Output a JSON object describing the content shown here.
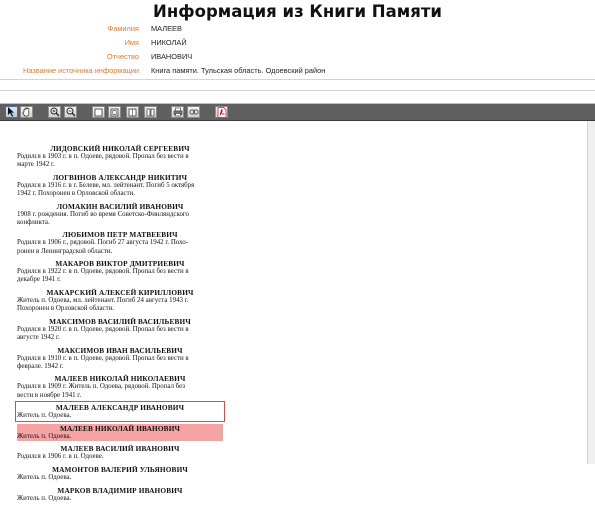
{
  "page": {
    "title": "Информация из Книги Памяти"
  },
  "meta": [
    {
      "label": "Фамилия",
      "value": "МАЛЕЕВ"
    },
    {
      "label": "Имя",
      "value": "НИКОЛАЙ"
    },
    {
      "label": "Отчество",
      "value": "ИВАНОВИЧ"
    },
    {
      "label": "Название источника информации",
      "value": "Книга памяти. Тульская область. Одоевский район"
    }
  ],
  "toolbar": {
    "buttons": [
      {
        "name": "select-tool-button",
        "icon": "cursor-icon"
      },
      {
        "name": "hand-tool-button",
        "icon": "hand-icon"
      },
      {
        "name": "zoom-in-button",
        "icon": "zoom-in-icon"
      },
      {
        "name": "zoom-out-button",
        "icon": "zoom-out-icon"
      },
      {
        "name": "single-page-button",
        "icon": "single-page-icon"
      },
      {
        "name": "fit-width-button",
        "icon": "fit-width-icon"
      },
      {
        "name": "two-page-button",
        "icon": "two-page-icon"
      },
      {
        "name": "book-view-button",
        "icon": "book-view-icon"
      },
      {
        "name": "print-button",
        "icon": "printer-icon"
      },
      {
        "name": "link-button",
        "icon": "link-icon"
      },
      {
        "name": "pdf-button",
        "icon": "pdf-icon"
      }
    ]
  },
  "document": {
    "entries": [
      {
        "name": "ЛИДОВСКИЙ НИКОЛАЙ СЕРГЕЕВИЧ",
        "lines": [
          "Родился в 1903 г. в п. Одоеве, рядовой. Пропал без вести в",
          "марте 1942 г."
        ]
      },
      {
        "name": "ЛОГВИНОВ АЛЕКСАНДР НИКИТИЧ",
        "lines": [
          "Родился в 1916 г. в г. Белеве, мл. лейтенант. Погиб 5 октября",
          "1942 г. Похоронен в Орловской области."
        ]
      },
      {
        "name": "ЛОМАКИН ВАСИЛИЙ ИВАНОВИЧ",
        "lines": [
          "1908 г. рождения. Погиб во время Советско-Финляндского",
          "конфликта."
        ]
      },
      {
        "name": "ЛЮБИМОВ ПЕТР МАТВЕЕВИЧ",
        "lines": [
          "Родился в 1906 г., рядовой. Погиб 27 августа 1942 г. Похо-",
          "ронен в Ленинградской области."
        ]
      },
      {
        "name": "МАКАРОВ ВИКТОР ДМИТРИЕВИЧ",
        "lines": [
          "Родился в 1922 г. в п. Одоеве, рядовой. Пропал без вести в",
          "декабре 1941 г."
        ]
      },
      {
        "name": "МАКАРСКИЙ АЛЕКСЕЙ КИРИЛЛОВИЧ",
        "lines": [
          "Житель п. Одоева, мл. лейтенант. Погиб 24 августа 1943 г.",
          "Похоронен в Орловской области."
        ]
      },
      {
        "name": "МАКСИМОВ ВАСИЛИЙ ВАСИЛЬЕВИЧ",
        "lines": [
          "Родился в 1920 г. в п. Одоеве, рядовой. Пропал без вести в",
          "августе 1942 г."
        ]
      },
      {
        "name": "МАКСИМОВ ИВАН ВАСИЛЬЕВИЧ",
        "lines": [
          "Родился в 1910 г. в п. Одоеве, рядовой. Пропал без вести в",
          "феврале. 1942 г."
        ]
      },
      {
        "name": "МАЛЕЕВ НИКОЛАЙ НИКОЛАЕВИЧ",
        "lines": [
          "Родился в 1909 г. Житель п. Одоева, рядовой. Пропал без",
          "вести в ноябре 1941 г."
        ]
      },
      {
        "name": "МАЛЕЕВ АЛЕКСАНДР ИВАНОВИЧ",
        "lines": [
          "Житель п. Одоева."
        ],
        "highlight": "outline"
      },
      {
        "name": "МАЛЕЕВ НИКОЛАЙ ИВАНОВИЧ",
        "lines": [
          "Житель п. Одоева."
        ],
        "highlight": "fill"
      },
      {
        "name": "МАЛЕЕВ ВАСИЛИЙ ИВАНОВИЧ",
        "lines": [
          "Родился в 1906 г. в п. Одоеве."
        ]
      },
      {
        "name": "МАМОНТОВ ВАЛЕРИЙ УЛЬЯНОВИЧ",
        "lines": [
          "Житель п. Одоева."
        ]
      },
      {
        "name": "МАРКОВ ВЛАДИМИР ИВАНОВИЧ",
        "lines": [
          "Житель п. Одоева."
        ]
      }
    ]
  }
}
